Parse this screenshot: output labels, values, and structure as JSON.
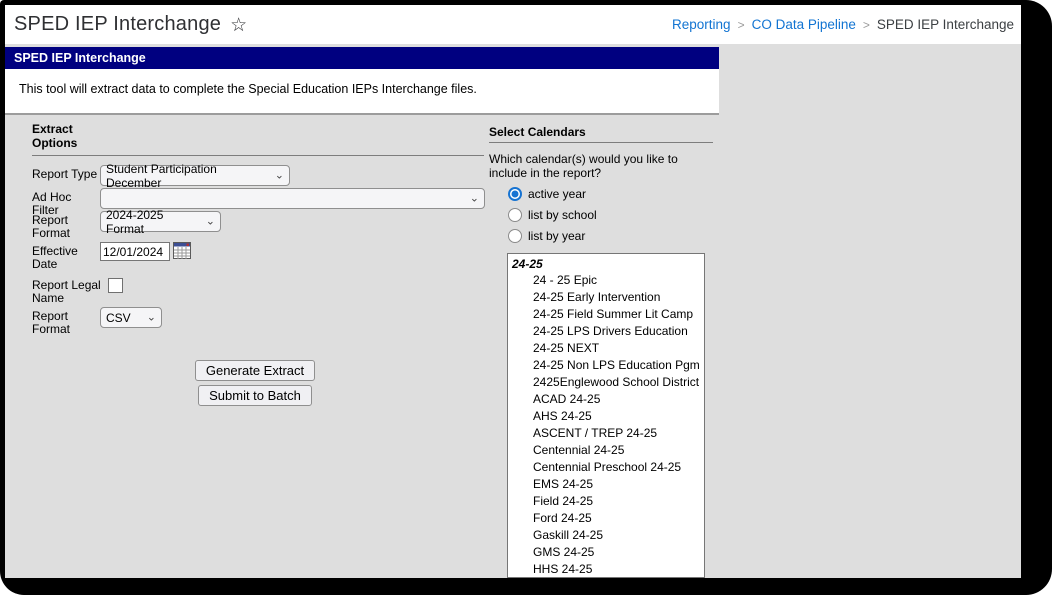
{
  "header": {
    "title": "SPED IEP Interchange",
    "star_icon": "☆",
    "breadcrumb": [
      {
        "label": "Reporting",
        "type": "link"
      },
      {
        "label": "CO Data Pipeline",
        "type": "link"
      },
      {
        "label": "SPED IEP Interchange",
        "type": "current"
      }
    ],
    "separator": ">"
  },
  "tool_header": {
    "title": "SPED IEP Interchange",
    "description": "This tool will extract data to complete the Special Education IEPs Interchange files."
  },
  "extract_options": {
    "heading": "Extract Options",
    "report_type": {
      "label": "Report Type",
      "value": "Student Participation December"
    },
    "ad_hoc_filter": {
      "label": "Ad Hoc Filter",
      "value": ""
    },
    "report_format_year": {
      "label": "Report Format",
      "value": "2024-2025 Format"
    },
    "effective_date": {
      "label": "Effective Date",
      "value": "12/01/2024"
    },
    "report_legal_name": {
      "label": "Report Legal Name",
      "checked": false
    },
    "report_format_file": {
      "label": "Report Format",
      "value": "CSV"
    },
    "buttons": {
      "generate": "Generate Extract",
      "submit_batch": "Submit to Batch"
    }
  },
  "select_calendars": {
    "heading": "Select Calendars",
    "question": "Which calendar(s) would you like to include in the report?",
    "radios": [
      {
        "label": "active year",
        "selected": true
      },
      {
        "label": "list by school",
        "selected": false
      },
      {
        "label": "list by year",
        "selected": false
      }
    ],
    "calendar_group": "24-25",
    "calendars": [
      "24 - 25 Epic",
      "24-25 Early Intervention",
      "24-25 Field Summer Lit Camp",
      "24-25 LPS Drivers Education",
      "24-25 NEXT",
      "24-25 Non LPS Education Pgm",
      "2425Englewood School District",
      "ACAD 24-25",
      "AHS 24-25",
      "ASCENT / TREP 24-25",
      "Centennial 24-25",
      "Centennial Preschool 24-25",
      "EMS 24-25",
      "Field 24-25",
      "Ford 24-25",
      "Gaskill 24-25",
      "GMS 24-25",
      "HHS 24-25"
    ]
  },
  "colors": {
    "title_bar": "#000080",
    "link_blue": "#1274d2",
    "page_bg": "#dedede",
    "accent_radio": "#1673d2"
  }
}
